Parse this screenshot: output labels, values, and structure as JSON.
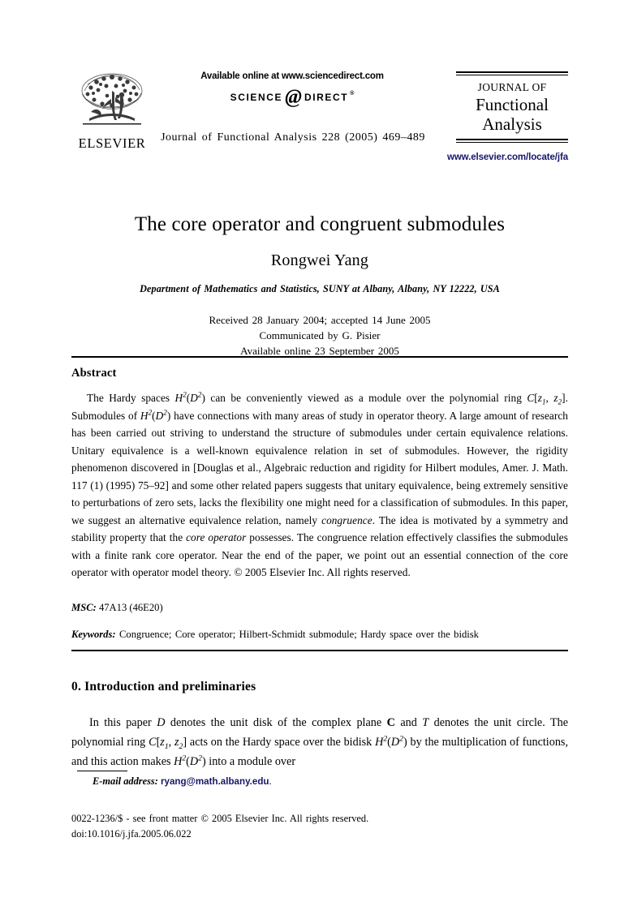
{
  "header": {
    "publisher_logo_text": "ELSEVIER",
    "sciencedirect_available": "Available online at www.sciencedirect.com",
    "sciencedirect_logo": {
      "left_word": "SCIENCE",
      "at_glyph": "@",
      "right_word": "DIRECT",
      "registered_mark": "®"
    },
    "journal_citation": "Journal of Functional Analysis 228 (2005) 469–489",
    "journal_mark": {
      "line1": "JOURNAL OF",
      "line2": "Functional",
      "line3": "Analysis"
    },
    "journal_url": "www.elsevier.com/locate/jfa"
  },
  "article": {
    "title": "The core operator and congruent submodules",
    "author": "Rongwei Yang",
    "affiliation": "Department of Mathematics and Statistics, SUNY at Albany, Albany, NY 12222, USA",
    "received_accepted": "Received 28 January 2004; accepted 14 June 2005",
    "communicated_by": "Communicated by G. Pisier",
    "available_online": "Available online 23 September 2005"
  },
  "abstract": {
    "heading": "Abstract",
    "text_parts": {
      "p1": "The Hardy spaces ",
      "m1a": "H",
      "m1b": "2",
      "m1c": "(",
      "m1d": "D",
      "m1e": "2",
      "m1f": ")",
      "p2": " can be conveniently viewed as a module over the polynomial ring ",
      "m2a": "C",
      "m2b": "[",
      "m2c": "z",
      "m2d": "1",
      "m2e": ", ",
      "m2f": "z",
      "m2g": "2",
      "m2h": "]",
      "p3": ". Submodules of ",
      "p4": " have connections with many areas of study in operator theory. A large amount of research has been carried out striving to understand the structure of submodules under certain equivalence relations. Unitary equivalence is a well-known equivalence relation in set of submodules. However, the rigidity phenomenon discovered in [Douglas et al., Algebraic reduction and rigidity for Hilbert modules, Amer. J. Math. 117 (1) (1995) 75–92] and some other related papers suggests that unitary equivalence, being extremely sensitive to perturbations of zero sets, lacks the flexibility one might need for a classification of submodules. In this paper, we suggest an alternative equivalence relation, namely ",
      "em1": "congruence",
      "p5": ". The idea is motivated by a symmetry and stability property that the ",
      "em2": "core operator",
      "p6": " possesses. The congruence relation effectively classifies the submodules with a finite rank core operator. Near the end of the paper, we point out an essential connection of the core operator with operator model theory.",
      "p7": " © 2005 Elsevier Inc. All rights reserved."
    },
    "full_text": "The Hardy spaces H2(D2) can be conveniently viewed as a module over the polynomial ring C[z1, z2]. Submodules of H2(D2) have connections with many areas of study in operator theory. A large amount of research has been carried out striving to understand the structure of submodules under certain equivalence relations. Unitary equivalence is a well-known equivalence relation in set of submodules. However, the rigidity phenomenon discovered in [Douglas et al., Algebraic reduction and rigidity for Hilbert modules, Amer. J. Math. 117 (1) (1995) 75–92] and some other related papers suggests that unitary equivalence, being extremely sensitive to perturbations of zero sets, lacks the flexibility one might need for a classification of submodules. In this paper, we suggest an alternative equivalence relation, namely congruence. The idea is motivated by a symmetry and stability property that the core operator possesses. The congruence relation effectively classifies the submodules with a finite rank core operator. Near the end of the paper, we point out an essential connection of the core operator with operator model theory. © 2005 Elsevier Inc. All rights reserved."
  },
  "msc": {
    "label": "MSC:",
    "value": "47A13 (46E20)"
  },
  "keywords": {
    "label": "Keywords:",
    "value": "Congruence; Core operator; Hilbert-Schmidt submodule; Hardy space over the bidisk"
  },
  "section": {
    "heading": "0. Introduction and preliminaries",
    "body_parts": {
      "s1": "In this paper ",
      "v1": "D",
      "s2": " denotes the unit disk of the complex plane ",
      "v2": "C",
      "s3": " and ",
      "v3": "T",
      "s4": " denotes the unit circle. The polynomial ring ",
      "v4a": "C",
      "v4b": "[",
      "v4c": "z",
      "v4d": "1",
      "v4e": ", ",
      "v4f": "z",
      "v4g": "2",
      "v4h": "]",
      "s5": " acts on the Hardy space over the bidisk ",
      "v5a": "H",
      "v5b": "2",
      "v5c": "(",
      "v5d": "D",
      "v5e": "2",
      "v5f": ")",
      "s6": " by the multiplication of functions, and this action makes ",
      "s7": " into a module over"
    },
    "full_text": "In this paper D denotes the unit disk of the complex plane C and T denotes the unit circle. The polynomial ring C[z1, z2] acts on the Hardy space over the bidisk H2(D2) by the multiplication of functions, and this action makes H2(D2) into a module over"
  },
  "footer": {
    "email_label": "E-mail address:",
    "email_address": "ryang@math.albany.edu",
    "email_trailing": ".",
    "front_matter": "0022-1236/$ - see front matter © 2005 Elsevier Inc. All rights reserved.",
    "doi": "doi:10.1016/j.jfa.2005.06.022"
  },
  "colors": {
    "link_blue": "#16166b",
    "text_black": "#000000",
    "page_background": "#ffffff"
  }
}
